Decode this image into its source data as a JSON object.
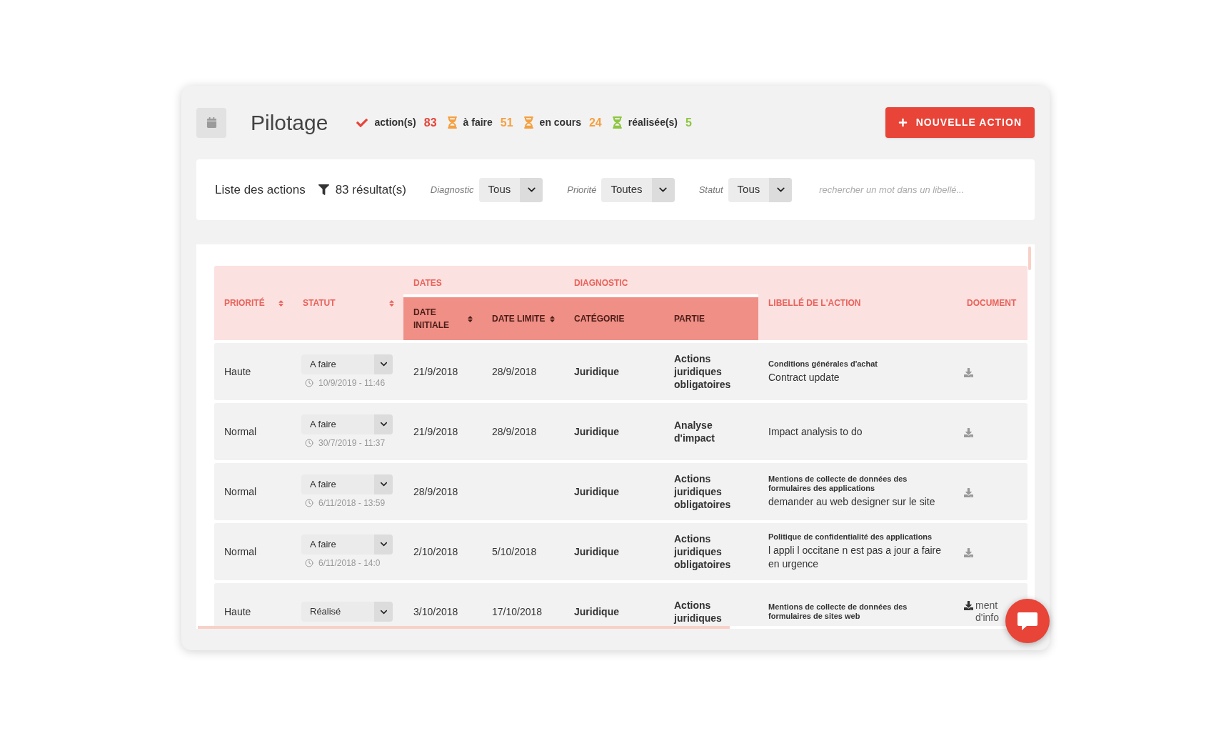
{
  "header": {
    "title": "Pilotage",
    "stats": [
      {
        "kind": "check",
        "label": "action(s)",
        "count": "83",
        "color": "#e84438"
      },
      {
        "kind": "hourglass",
        "label": "à faire",
        "count": "51",
        "color": "#f5a040"
      },
      {
        "kind": "hourglass",
        "label": "en cours",
        "count": "24",
        "color": "#f5a040"
      },
      {
        "kind": "hourglass",
        "label": "réalisée(s)",
        "count": "5",
        "color": "#8dc63f"
      }
    ],
    "button": "NOUVELLE ACTION"
  },
  "filter_bar": {
    "title": "Liste des actions",
    "results": "83 résultat(s)",
    "filters": [
      {
        "label": "Diagnostic",
        "value": "Tous"
      },
      {
        "label": "Priorité",
        "value": "Toutes"
      },
      {
        "label": "Statut",
        "value": "Tous"
      }
    ],
    "search": {
      "placeholder": "rechercher un mot dans un libellé..."
    }
  },
  "table": {
    "columns": [
      {
        "label": "PRIORITÉ",
        "sortable": true
      },
      {
        "label": "STATUT",
        "sortable": true
      },
      {
        "label": "DATES",
        "children": [
          {
            "label": "DATE INITIALE",
            "sortable": true
          },
          {
            "label": "DATE LIMITE",
            "sortable": true
          }
        ]
      },
      {
        "label": "DIAGNOSTIC",
        "children": [
          {
            "label": "CATÉGORIE",
            "sortable": false
          },
          {
            "label": "PARTIE",
            "sortable": false
          }
        ]
      },
      {
        "label": "LIBELLÉ DE L'ACTION",
        "sortable": false
      },
      {
        "label": "DOCUMENT",
        "sortable": false
      }
    ],
    "rows": [
      {
        "priority": "Haute",
        "status": "A faire",
        "updated": "10/9/2019 - 11:46",
        "date_initiale": "21/9/2018",
        "date_limite": "28/9/2018",
        "categorie": "Juridique",
        "partie": "Actions juridiques obligatoires",
        "title": "Conditions générales d'achat",
        "description": "Contract update"
      },
      {
        "priority": "Normal",
        "status": "A faire",
        "updated": "30/7/2019 - 11:37",
        "date_initiale": "21/9/2018",
        "date_limite": "28/9/2018",
        "categorie": "Juridique",
        "partie": "Analyse d'impact",
        "description": "Impact analysis to do"
      },
      {
        "priority": "Normal",
        "status": "A faire",
        "updated": "6/11/2018 - 13:59",
        "date_initiale": "28/9/2018",
        "categorie": "Juridique",
        "partie": "Actions juridiques obligatoires",
        "title": "Mentions de collecte de données des formulaires des applications",
        "description": "demander au web designer sur le site"
      },
      {
        "priority": "Normal",
        "status": "A faire",
        "updated": "6/11/2018 - 14:0",
        "date_initiale": "2/10/2018",
        "date_limite": "5/10/2018",
        "categorie": "Juridique",
        "partie": "Actions juridiques obligatoires",
        "title": "Politique de confidentialité des applications",
        "description": "l appli l occitane n est pas a jour a faire en urgence"
      },
      {
        "priority": "Haute",
        "status": "Réalisé",
        "date_initiale": "3/10/2018",
        "date_limite": "17/10/2018",
        "categorie": "Juridique",
        "partie": "Actions juridiques",
        "title": "Mentions de collecte de données des formulaires de sites web",
        "document": "ment d'info"
      }
    ]
  }
}
